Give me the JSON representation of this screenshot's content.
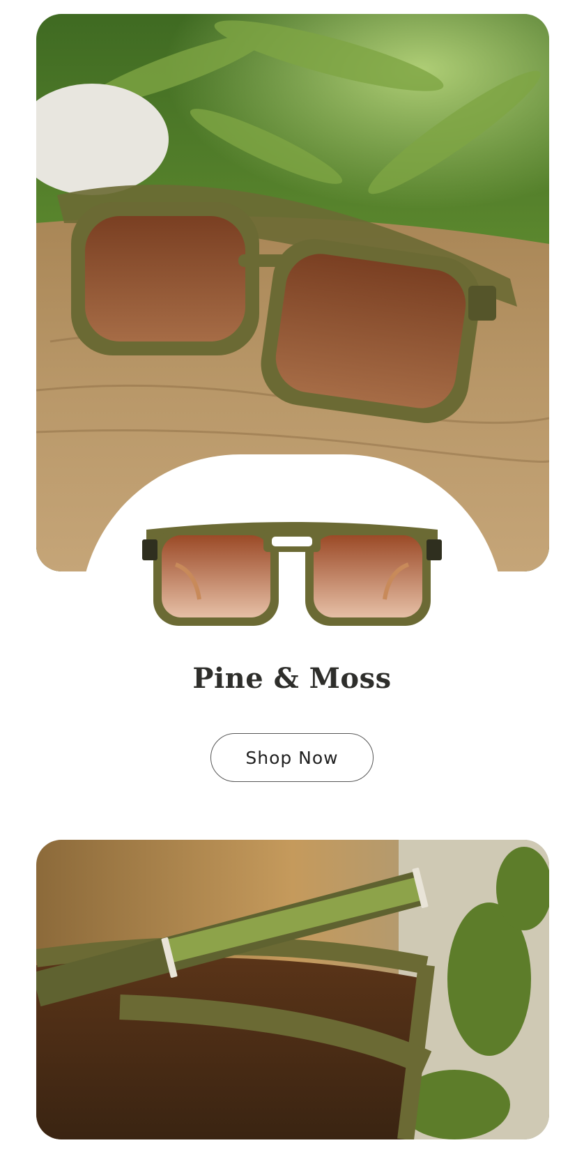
{
  "product": {
    "name": "Pine & Moss",
    "cta_label": "Shop Now"
  },
  "images": {
    "hero": "sunglasses-on-wood-log-with-fern",
    "product_shot": "sunglasses-front-view",
    "detail": "moss-inlay-temple-closeup"
  },
  "colors": {
    "frame_olive": "#6b6a34",
    "lens_brown": "#a55a33",
    "wood": "#b89567",
    "foliage": "#4f7a2a",
    "text_dark": "#2e2e2b"
  }
}
